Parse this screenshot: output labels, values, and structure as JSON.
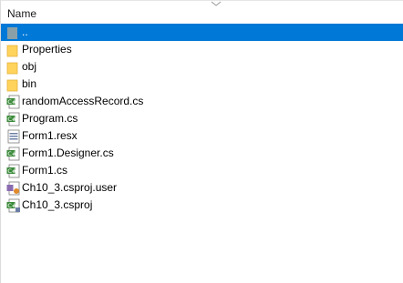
{
  "header": {
    "name_label": "Name"
  },
  "files": [
    {
      "name": "..",
      "kind": "parent-folder",
      "selected": true
    },
    {
      "name": "Properties",
      "kind": "folder"
    },
    {
      "name": "obj",
      "kind": "folder"
    },
    {
      "name": "bin",
      "kind": "folder"
    },
    {
      "name": "randomAccessRecord.cs",
      "kind": "csharp-file"
    },
    {
      "name": "Program.cs",
      "kind": "csharp-file"
    },
    {
      "name": "Form1.resx",
      "kind": "resx-file"
    },
    {
      "name": "Form1.Designer.cs",
      "kind": "csharp-file"
    },
    {
      "name": "Form1.cs",
      "kind": "csharp-file"
    },
    {
      "name": "Ch10_3.csproj.user",
      "kind": "csproj-user-file"
    },
    {
      "name": "Ch10_3.csproj",
      "kind": "csproj-file"
    }
  ],
  "colors": {
    "selection": "#0078d7",
    "folder": "#ffd35c",
    "csharp": "#3a8a3a"
  }
}
